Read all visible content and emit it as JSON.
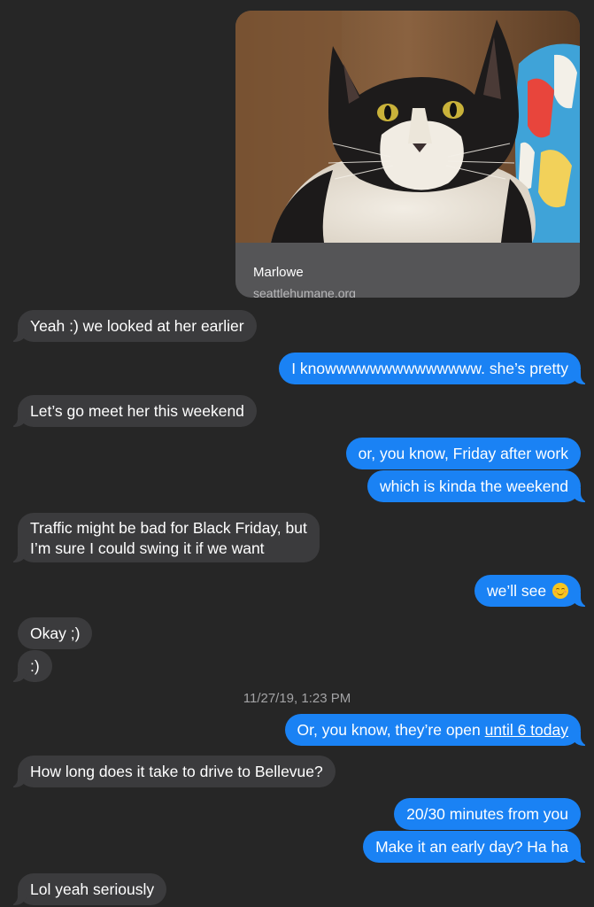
{
  "link_preview": {
    "title": "Marlowe",
    "domain": "seattlehumane.org",
    "image_alt": "black-and-white-long-haired-cat-photo"
  },
  "messages": [
    {
      "from": "them",
      "text": "Yeah :) we looked at her earlier"
    },
    {
      "from": "me",
      "text": "I knowwwwwwwwwwwwww. she’s pretty"
    },
    {
      "from": "them",
      "text": "Let’s go meet her this weekend"
    },
    {
      "from": "me",
      "text": "or, you know, Friday after work"
    },
    {
      "from": "me",
      "text": "which is kinda the weekend"
    },
    {
      "from": "them",
      "line1": "Traffic might be bad for Black Friday, but",
      "line2": "I’m sure I could swing it if we want"
    },
    {
      "from": "me",
      "text": "we’ll see",
      "emoji": "smiling-face-emoji"
    },
    {
      "from": "them",
      "text": "Okay ;)"
    },
    {
      "from": "them",
      "text": ":)"
    },
    {
      "from": "me",
      "text": "Or, you know, they’re open ",
      "link": "until 6 today"
    },
    {
      "from": "them",
      "text": "How long does it take to drive to Bellevue?"
    },
    {
      "from": "me",
      "text": "20/30 minutes from you"
    },
    {
      "from": "me",
      "text": "Make it an early day? Ha ha"
    },
    {
      "from": "them",
      "text": "Lol yeah seriously"
    }
  ],
  "timestamp": "11/27/19, 1:23 PM",
  "colors": {
    "background": "#262626",
    "incoming_bubble": "#3b3b3d",
    "outgoing_bubble": "#1a82f4",
    "link_card": "#555557"
  }
}
